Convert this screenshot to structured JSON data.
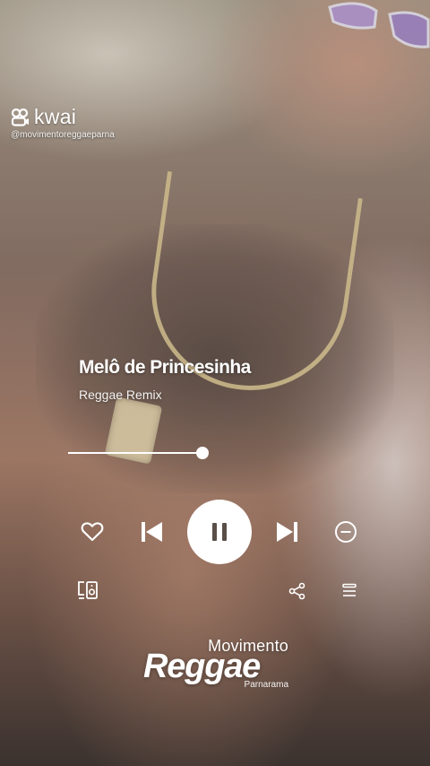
{
  "watermark": {
    "app_name": "kwai",
    "handle": "@movimentoreggaeparna",
    "logo_icon": "kwai-logo-icon"
  },
  "player": {
    "title": "Melô de Princesinha",
    "artist": "Reggae Remix",
    "progress": 1.0,
    "state": "playing",
    "controls": {
      "like_icon": "heart-icon",
      "previous_icon": "skip-previous-icon",
      "play_pause_icon": "pause-icon",
      "next_icon": "skip-next-icon",
      "remove_icon": "minus-circle-icon",
      "device_icon": "connect-device-icon",
      "share_icon": "share-icon",
      "queue_icon": "queue-icon"
    }
  },
  "brand": {
    "top": "Movimento",
    "main": "Reggae",
    "sub": "Parnarama"
  },
  "colors": {
    "accent": "#ffffff",
    "icon_dark": "#5a4e48"
  }
}
